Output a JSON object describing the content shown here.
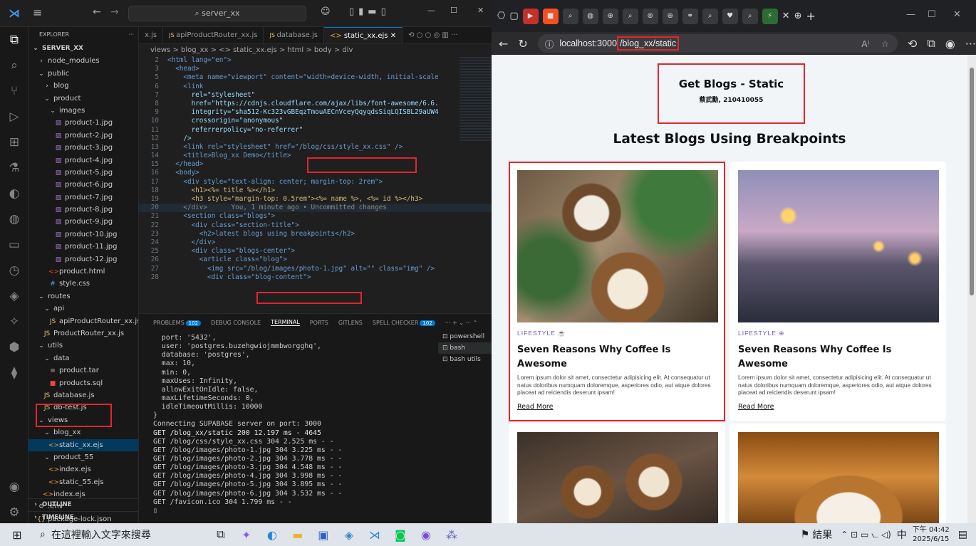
{
  "vscode": {
    "search": "server_xx",
    "explorer_title": "EXPLORER",
    "root": "SERVER_XX",
    "tree": [
      {
        "label": "node_modules",
        "indent": 1,
        "kind": "folder-closed"
      },
      {
        "label": "public",
        "indent": 1,
        "kind": "folder-open"
      },
      {
        "label": "blog",
        "indent": 2,
        "kind": "folder-closed"
      },
      {
        "label": "product",
        "indent": 2,
        "kind": "folder-open"
      },
      {
        "label": "images",
        "indent": 3,
        "kind": "folder-open"
      },
      {
        "label": "product-1.jpg",
        "indent": 4,
        "kind": "image"
      },
      {
        "label": "product-2.jpg",
        "indent": 4,
        "kind": "image"
      },
      {
        "label": "product-3.jpg",
        "indent": 4,
        "kind": "image"
      },
      {
        "label": "product-4.jpg",
        "indent": 4,
        "kind": "image"
      },
      {
        "label": "product-5.jpg",
        "indent": 4,
        "kind": "image"
      },
      {
        "label": "product-6.jpg",
        "indent": 4,
        "kind": "image"
      },
      {
        "label": "product-7.jpg",
        "indent": 4,
        "kind": "image"
      },
      {
        "label": "product-8.jpg",
        "indent": 4,
        "kind": "image"
      },
      {
        "label": "product-9.jpg",
        "indent": 4,
        "kind": "image"
      },
      {
        "label": "product-10.jpg",
        "indent": 4,
        "kind": "image"
      },
      {
        "label": "product-11.jpg",
        "indent": 4,
        "kind": "image"
      },
      {
        "label": "product-12.jpg",
        "indent": 4,
        "kind": "image"
      },
      {
        "label": "product.html",
        "indent": 3,
        "kind": "html"
      },
      {
        "label": "style.css",
        "indent": 3,
        "kind": "css"
      },
      {
        "label": "routes",
        "indent": 1,
        "kind": "folder-open"
      },
      {
        "label": "api",
        "indent": 2,
        "kind": "folder-open"
      },
      {
        "label": "apiProductRouter_xx.js",
        "indent": 3,
        "kind": "js"
      },
      {
        "label": "ProductRouter_xx.js",
        "indent": 2,
        "kind": "js"
      },
      {
        "label": "utils",
        "indent": 1,
        "kind": "folder-open"
      },
      {
        "label": "data",
        "indent": 2,
        "kind": "folder-open"
      },
      {
        "label": "product.tar",
        "indent": 3,
        "kind": "file"
      },
      {
        "label": "products.sql",
        "indent": 3,
        "kind": "sql"
      },
      {
        "label": "database.js",
        "indent": 2,
        "kind": "js"
      },
      {
        "label": "db-test.js",
        "indent": 2,
        "kind": "js"
      },
      {
        "label": "views",
        "indent": 1,
        "kind": "folder-open"
      },
      {
        "label": "blog_xx",
        "indent": 2,
        "kind": "folder-open"
      },
      {
        "label": "static_xx.ejs",
        "indent": 3,
        "kind": "ejs"
      },
      {
        "label": "product_55",
        "indent": 2,
        "kind": "folder-open"
      },
      {
        "label": "index.ejs",
        "indent": 3,
        "kind": "ejs"
      },
      {
        "label": "static_55.ejs",
        "indent": 3,
        "kind": "ejs"
      },
      {
        "label": "index.ejs",
        "indent": 2,
        "kind": "ejs"
      },
      {
        "label": ".env",
        "indent": 1,
        "kind": "gear"
      },
      {
        "label": "package-lock.json",
        "indent": 1,
        "kind": "json"
      }
    ],
    "outline": "OUTLINE",
    "timeline": "TIMELINE",
    "tabs": [
      "x.js",
      "apiProductRouter_xx.js",
      "database.js",
      "static_xx.ejs"
    ],
    "breadcrumb": "views > blog_xx > <> static_xx.ejs > html > body > div",
    "code": [
      {
        "n": "2",
        "t": "<html lang=\"en\">"
      },
      {
        "n": "3",
        "t": "  <head>"
      },
      {
        "n": "5",
        "t": "    <meta name=\"viewport\" content=\"width=device-width, initial-scale"
      },
      {
        "n": "6",
        "t": "    <link"
      },
      {
        "n": "7",
        "t": "      rel=\"stylesheet\""
      },
      {
        "n": "8",
        "t": "      href=\"https://cdnjs.cloudflare.com/ajax/libs/font-awesome/6.6."
      },
      {
        "n": "9",
        "t": "      integrity=\"sha512-Kc323vGBEqzTmouAECnVceyQqyqdsSiqLQISBL29aUW4"
      },
      {
        "n": "10",
        "t": "      crossorigin=\"anonymous\""
      },
      {
        "n": "11",
        "t": "      referrerpolicy=\"no-referrer\""
      },
      {
        "n": "12",
        "t": "    />"
      },
      {
        "n": "13",
        "t": "    <link rel=\"stylesheet\" href=\"/blog/css/style_xx.css\" />"
      },
      {
        "n": "14",
        "t": "    <title>Blog_xx Demo</title>"
      },
      {
        "n": "15",
        "t": "  </head>"
      },
      {
        "n": "16",
        "t": "  <body>"
      },
      {
        "n": "17",
        "t": "    <div style=\"text-align: center; margin-top: 2rem\">"
      },
      {
        "n": "18",
        "t": "      <h1><%= title %></h1>"
      },
      {
        "n": "19",
        "t": "      <h3 style=\"margin-top: 0.5rem\"><%= name %>, <%= id %></h3>"
      },
      {
        "n": "20",
        "t": "    </div>      You, 1 minute ago • Uncommitted changes"
      },
      {
        "n": "21",
        "t": "    <section class=\"blogs\">"
      },
      {
        "n": "22",
        "t": "      <div class=\"section-title\">"
      },
      {
        "n": "23",
        "t": "        <h2>latest blogs using breakpoints</h2>"
      },
      {
        "n": "24",
        "t": "      </div>"
      },
      {
        "n": "25",
        "t": "      <div class=\"blogs-center\">"
      },
      {
        "n": "26",
        "t": "        <article class=\"blog\">"
      },
      {
        "n": "27",
        "t": "          <img src=\"/blog/images/photo-1.jpg\" alt=\"\" class=\"img\" />"
      },
      {
        "n": "28",
        "t": "          <div class=\"blog-content\">"
      }
    ],
    "panel_tabs": [
      "PROBLEMS",
      "DEBUG CONSOLE",
      "TERMINAL",
      "PORTS",
      "GITLENS",
      "SPELL CHECKER"
    ],
    "problems_count": "102",
    "spell_count": "102",
    "terminal": [
      "  port: '5432',",
      "  user: 'postgres.buzehgwiojmmbworgghq',",
      "  database: 'postgres',",
      "  max: 10,",
      "  min: 0,",
      "  maxUses: Infinity,",
      "  allowExitOnIdle: false,",
      "  maxLifetimeSeconds: 0,",
      "  idleTimeoutMillis: 10000",
      "}",
      "Connecting SUPABASE server on port: 3000",
      "GET /blog_xx/static 200 12.197 ms - 4645",
      "GET /blog/css/style_xx.css 304 2.525 ms - -",
      "GET /blog/images/photo-1.jpg 304 3.225 ms - -",
      "GET /blog/images/photo-2.jpg 304 3.778 ms - -",
      "GET /blog/images/photo-3.jpg 304 4.548 ms - -",
      "GET /blog/images/photo-4.jpg 304 3.998 ms - -",
      "GET /blog/images/photo-5.jpg 304 3.895 ms - -",
      "GET /blog/images/photo-6.jpg 304 3.532 ms - -",
      "GET /favicon.ico 304 1.799 ms - -"
    ],
    "shells": [
      "powershell",
      "bash",
      "bash utils"
    ]
  },
  "browser": {
    "url_host": "localhost:3000",
    "url_path": "/blog_xx/static",
    "page_title": "Get Blogs - Static",
    "subtitle": "蔡武勳, 210410055",
    "section_title": "Latest Blogs Using Breakpoints",
    "cards": [
      {
        "category": "LIFESTYLE",
        "title": "Seven Reasons Why Coffee Is Awesome",
        "text": "Lorem ipsum dolor sit amet, consectetur adipisicing elit. At consequatur ut natus doloribus numquam doloremque, asperiores odio, aut atque dolores placeat ad reiciendis deserunt ipsam!",
        "link": "Read More"
      },
      {
        "category": "LIFESTYLE",
        "title": "Seven Reasons Why Coffee Is Awesome",
        "text": "Lorem ipsum dolor sit amet, consectetur adipisicing elit. At consequatur ut natus doloribus numquam doloremque, asperiores odio, aut atque dolores placeat ad reiciendis deserunt ipsam!",
        "link": "Read More"
      }
    ]
  },
  "taskbar": {
    "search": "在這裡輸入文字來搜尋",
    "news": "結果",
    "ime": "中",
    "time": "下午 04:42",
    "date": "2025/6/15"
  },
  "colors": {
    "accent": "#0078d4",
    "highlight": "#e0262d"
  }
}
